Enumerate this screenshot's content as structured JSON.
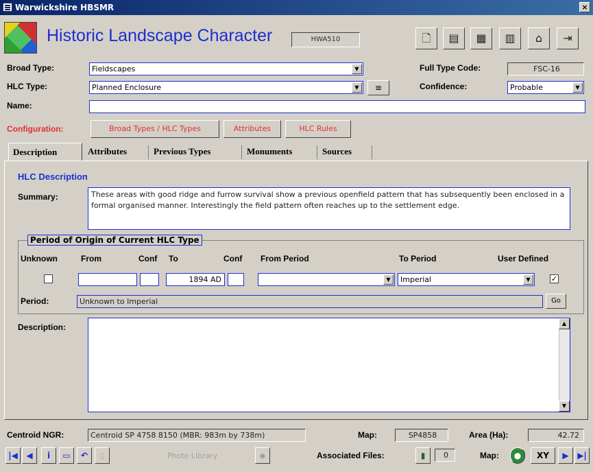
{
  "window": {
    "title": "Warwickshire HBSMR",
    "close": "×"
  },
  "header": {
    "title": "Historic Landscape Character",
    "record_code": "HWA510",
    "toolbar_icons": [
      "preview-icon",
      "list-icon",
      "map-icon",
      "delete-icon",
      "building-icon",
      "exit-icon"
    ]
  },
  "form": {
    "broad_type_label": "Broad Type:",
    "broad_type_value": "Fieldscapes",
    "hlc_type_label": "HLC Type:",
    "hlc_type_value": "Planned Enclosure",
    "hlc_type_btn": "≡",
    "full_type_code_label": "Full Type Code:",
    "full_type_code_value": "FSC-16",
    "confidence_label": "Confidence:",
    "confidence_value": "Probable",
    "name_label": "Name:",
    "name_value": ""
  },
  "configuration": {
    "label": "Configuration:",
    "buttons": [
      "Broad Types / HLC Types",
      "Attributes",
      "HLC Rules"
    ]
  },
  "tabs": [
    "Description",
    "Attributes",
    "Previous Types",
    "Monuments",
    "Sources"
  ],
  "description": {
    "section_title": "HLC Description",
    "summary_label": "Summary:",
    "summary_text": "These areas with good ridge and furrow survival show a previous openfield pattern that has subsequently been enclosed in a formal organised manner.  Interestingly the field pattern often reaches up to the settlement edge.",
    "period_group_title": "Period of Origin of Current HLC Type",
    "col_unknown": "Unknown",
    "col_from": "From",
    "col_conf1": "Conf",
    "col_to": "To",
    "col_conf2": "Conf",
    "col_from_period": "From Period",
    "col_to_period": "To Period",
    "col_user_defined": "User Defined",
    "from_value": "",
    "to_value": "1894 AD",
    "from_period_value": "",
    "to_period_value": "Imperial",
    "unknown_checked": "",
    "user_defined_checked": "✓",
    "period_label": "Period:",
    "period_value": "Unknown to Imperial",
    "period_btn": "Go",
    "description_label": "Description:",
    "description_text": ""
  },
  "status": {
    "centroid_label": "Centroid NGR:",
    "centroid_value": "Centroid SP 4758 8150  (MBR: 983m by 738m)",
    "map_label": "Map:",
    "map_value": "SP4858",
    "area_label": "Area (Ha):",
    "area_value": "42.72",
    "photo_library": "Photo Library",
    "associated_files_label": "Associated Files:",
    "associated_files_count": "0",
    "map2_label": "Map:",
    "xy_label": "XY"
  },
  "colors": {
    "accent": "#1c2fd0",
    "config_red": "#e03030",
    "title_bar": "#0a246a"
  }
}
